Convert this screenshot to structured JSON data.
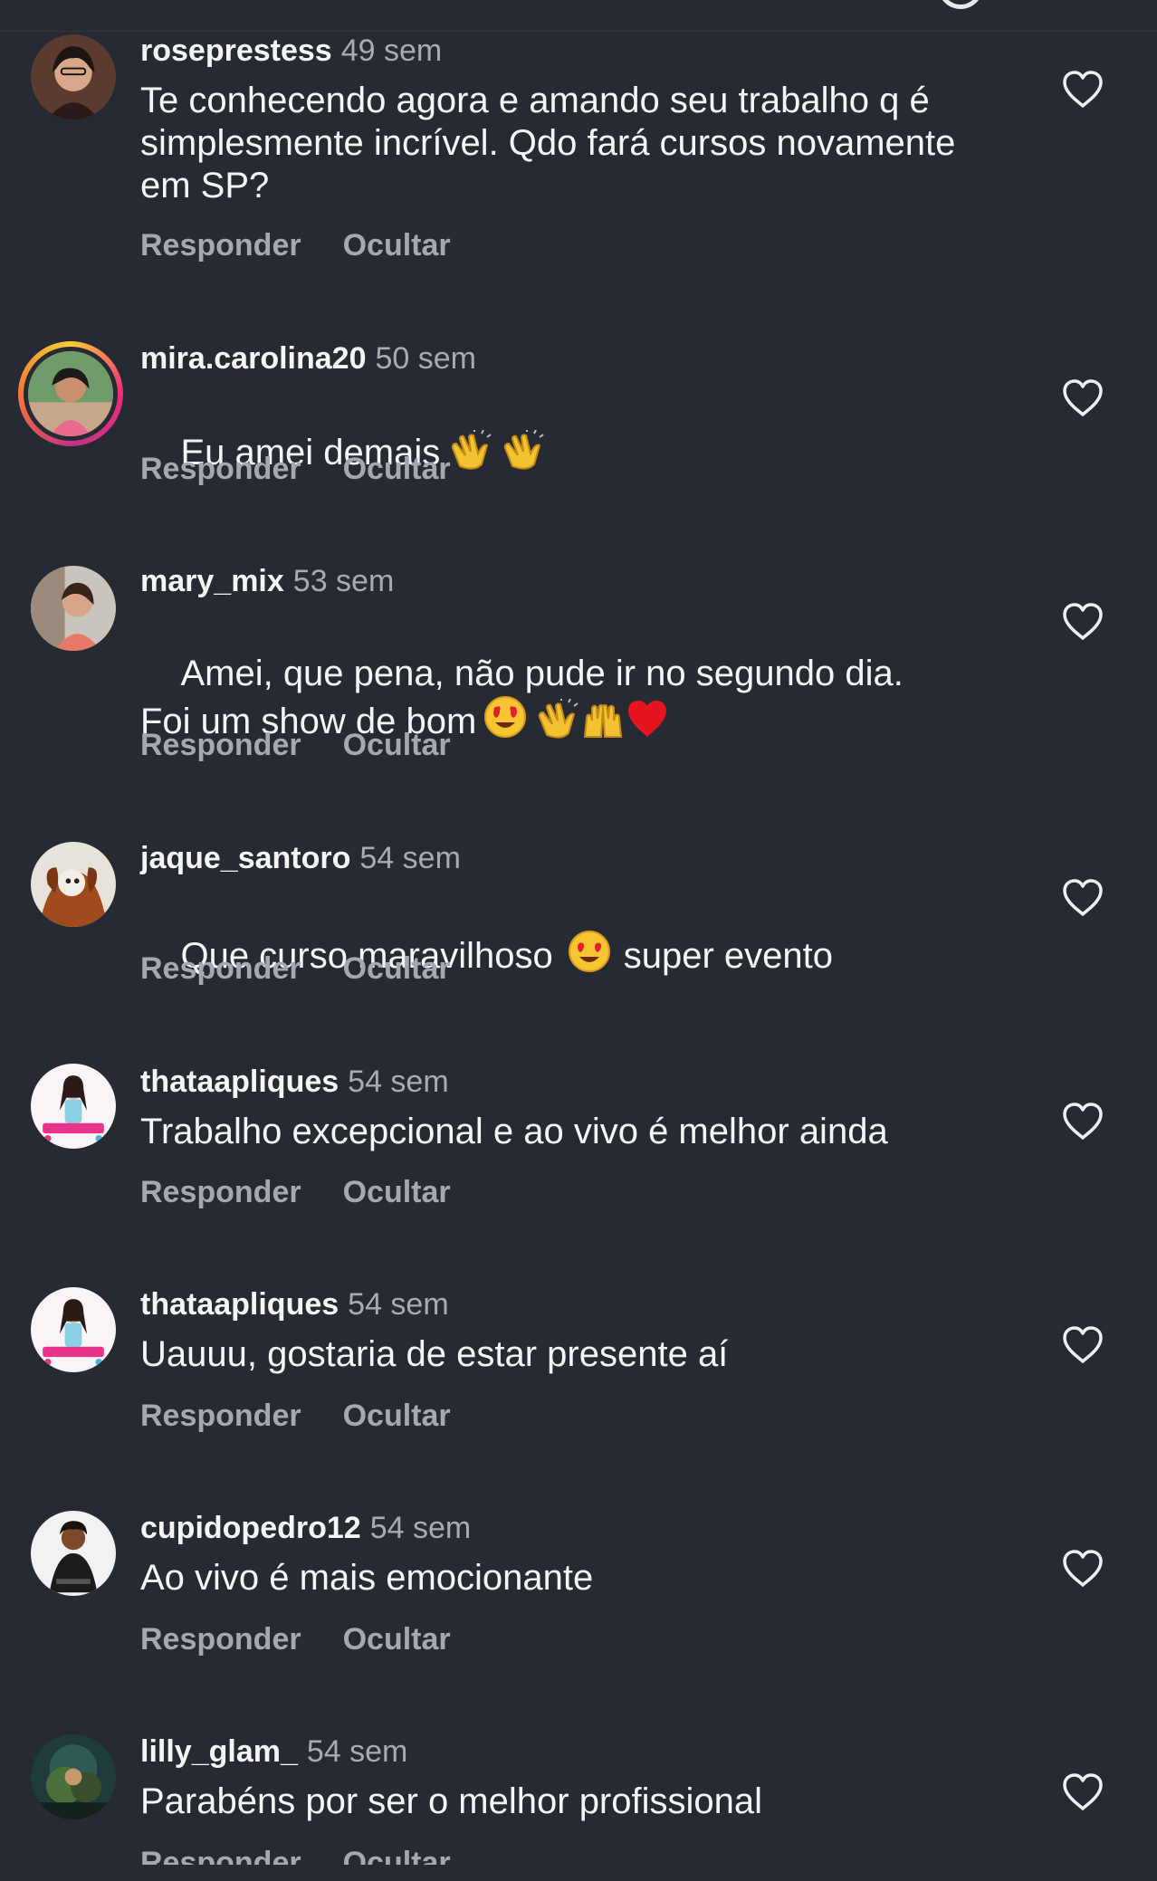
{
  "comments": [
    {
      "username": "roseprestess",
      "time": "49 sem",
      "text": "Te conhecendo agora e amando seu trabalho q é\nsimplesmente incrível. Qdo fará cursos novamente\nem SP?",
      "reply": "Responder",
      "hide": "Ocultar"
    },
    {
      "username": "mira.carolina20",
      "time": "50 sem",
      "text": "Eu amei demais",
      "emojis": [
        "clapping-hands",
        "clapping-hands"
      ],
      "reply": "Responder",
      "hide": "Ocultar"
    },
    {
      "username": "mary_mix",
      "time": "53 sem",
      "text": "Amei, que pena, não pude ir no segundo dia.\nFoi um show de bom",
      "emojis": [
        "heart-eyes",
        "clapping-hands",
        "raising-hands",
        "red-heart"
      ],
      "reply": "Responder",
      "hide": "Ocultar"
    },
    {
      "username": "jaque_santoro",
      "time": "54 sem",
      "text_before": "Que curso maravilhoso",
      "emojis": [
        "heart-eyes"
      ],
      "text_after": "super evento",
      "reply": "Responder",
      "hide": "Ocultar"
    },
    {
      "username": "thataapliques",
      "time": "54 sem",
      "text": "Trabalho excepcional e ao vivo é melhor ainda",
      "reply": "Responder",
      "hide": "Ocultar"
    },
    {
      "username": "thataapliques",
      "time": "54 sem",
      "text": "Uauuu, gostaria de estar presente aí",
      "reply": "Responder",
      "hide": "Ocultar"
    },
    {
      "username": "cupidopedro12",
      "time": "54 sem",
      "text": "Ao vivo é mais emocionante",
      "reply": "Responder",
      "hide": "Ocultar"
    },
    {
      "username": "lilly_glam_",
      "time": "54 sem",
      "text": "Parabéns por ser o melhor profissional",
      "reply": "Responder",
      "hide": "Ocultar"
    }
  ],
  "icons": {
    "like": "heart-outline-icon"
  },
  "colors": {
    "background": "#262a33",
    "text": "#f5f5f5",
    "muted": "#a8abb3"
  }
}
